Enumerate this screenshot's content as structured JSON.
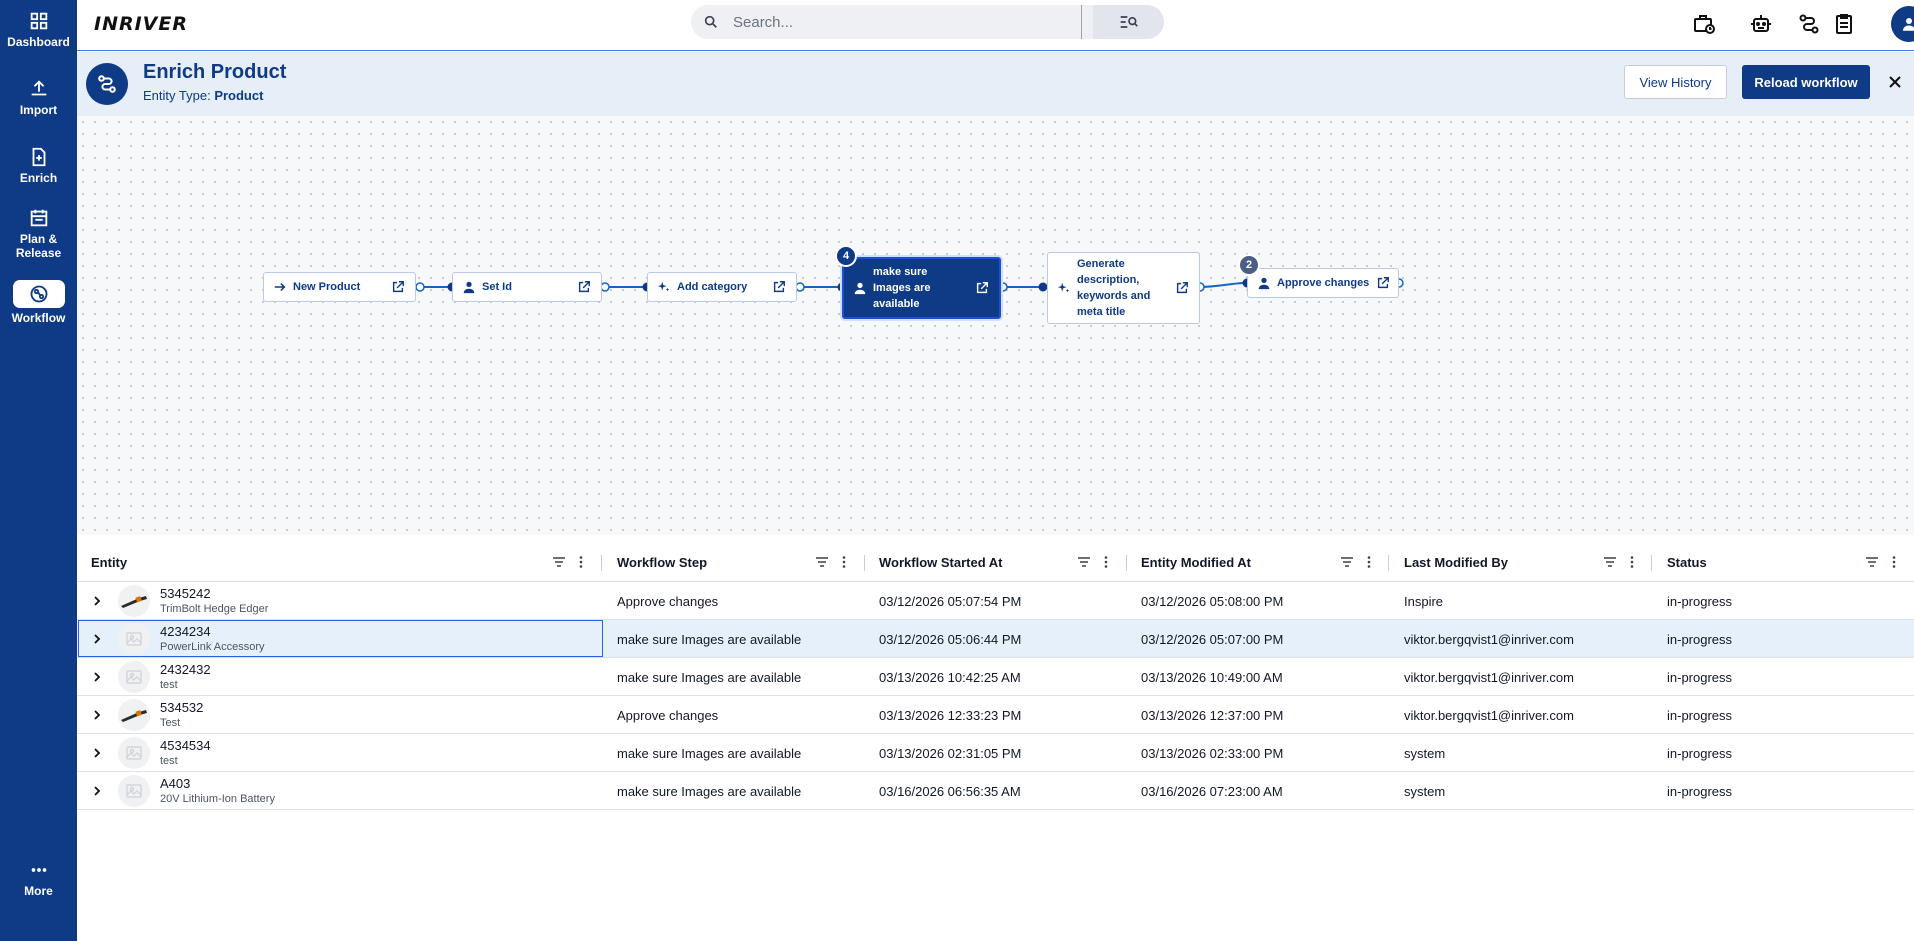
{
  "sidebar": {
    "items": [
      {
        "label": "Dashboard",
        "icon": "grid-icon"
      },
      {
        "label": "Import",
        "icon": "upload-icon"
      },
      {
        "label": "Enrich",
        "icon": "file-plus-icon"
      },
      {
        "label": "Plan &\nRelease",
        "icon": "calendar-icon"
      },
      {
        "label": "Workflow",
        "icon": "workflow-icon"
      },
      {
        "label": "More",
        "icon": "more-dots-icon"
      }
    ]
  },
  "topbar": {
    "logo": "INRIVER",
    "search_placeholder": "Search...",
    "icons": [
      "briefcase-clock-icon",
      "robot-icon",
      "workflow-icon",
      "clipboard-icon",
      "user-icon"
    ]
  },
  "header": {
    "title": "Enrich Product",
    "entity_type_label": "Entity Type:",
    "entity_type_value": "Product",
    "view_history": "View History",
    "reload_workflow": "Reload workflow"
  },
  "workflow": {
    "nodes": [
      {
        "label": "New Product",
        "icon": "arrow-right-icon"
      },
      {
        "label": "Set Id",
        "icon": "person-icon"
      },
      {
        "label": "Add category",
        "icon": "sparkle-icon"
      },
      {
        "label": "make sure Images are available",
        "icon": "person-icon",
        "count": "4",
        "active": true
      },
      {
        "label": "Generate description, keywords and meta title",
        "icon": "sparkle-icon"
      },
      {
        "label": "Approve changes",
        "icon": "person-icon",
        "count": "2"
      }
    ]
  },
  "table": {
    "columns": [
      "Entity",
      "Workflow Step",
      "Workflow Started At",
      "Entity Modified At",
      "Last Modified By",
      "Status"
    ],
    "rows": [
      {
        "id": "5345242",
        "name": "TrimBolt Hedge Edger",
        "thumb": "tool-image",
        "step": "Approve changes",
        "started": "03/12/2026 05:07:54 PM",
        "modified": "03/12/2026 05:08:00 PM",
        "by": "Inspire",
        "status": "in-progress"
      },
      {
        "id": "4234234",
        "name": "PowerLink Accessory",
        "thumb": "placeholder-image",
        "step": "make sure Images are available",
        "started": "03/12/2026 05:06:44 PM",
        "modified": "03/12/2026 05:07:00 PM",
        "by": "viktor.bergqvist1@inriver.com",
        "status": "in-progress",
        "selected": true
      },
      {
        "id": "2432432",
        "name": "test",
        "thumb": "placeholder-image",
        "step": "make sure Images are available",
        "started": "03/13/2026 10:42:25 AM",
        "modified": "03/13/2026 10:49:00 AM",
        "by": "viktor.bergqvist1@inriver.com",
        "status": "in-progress"
      },
      {
        "id": "534532",
        "name": "Test",
        "thumb": "tool-image",
        "step": "Approve changes",
        "started": "03/13/2026 12:33:23 PM",
        "modified": "03/13/2026 12:37:00 PM",
        "by": "viktor.bergqvist1@inriver.com",
        "status": "in-progress"
      },
      {
        "id": "4534534",
        "name": "test",
        "thumb": "placeholder-image",
        "step": "make sure Images are available",
        "started": "03/13/2026 02:31:05 PM",
        "modified": "03/13/2026 02:33:00 PM",
        "by": "system",
        "status": "in-progress"
      },
      {
        "id": "A403",
        "name": "20V Lithium-Ion Battery",
        "thumb": "placeholder-image",
        "step": "make sure Images are available",
        "started": "03/16/2026 06:56:35 AM",
        "modified": "03/16/2026 07:23:00 AM",
        "by": "system",
        "status": "in-progress"
      }
    ]
  },
  "colors": {
    "brand": "#0e3a86",
    "accent": "#1d4ed8",
    "selected_row": "#e6f0fb"
  }
}
